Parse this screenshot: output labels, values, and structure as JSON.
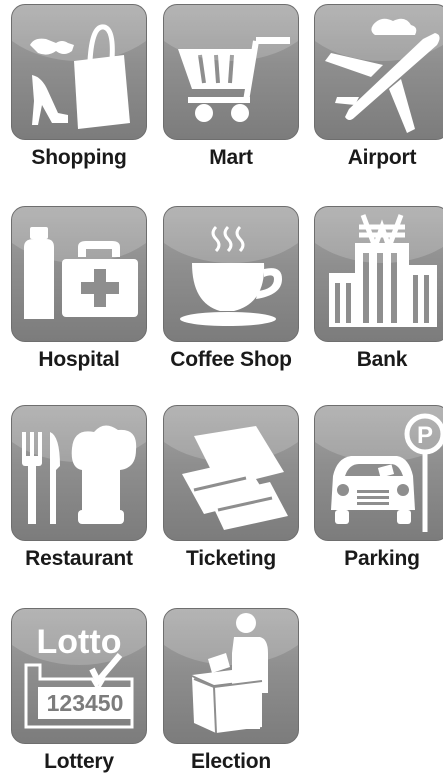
{
  "colors": {
    "icon_bg_top": "#a4a4a4",
    "icon_bg_bottom": "#7c7c7c",
    "glyph": "#ffffff",
    "label": "#1a1a1a"
  },
  "tiles": [
    {
      "label": "Shopping",
      "icon": "shopping-icon"
    },
    {
      "label": "Mart",
      "icon": "cart-icon"
    },
    {
      "label": "Airport",
      "icon": "airplane-icon"
    },
    {
      "label": "Hospital",
      "icon": "hospital-icon"
    },
    {
      "label": "Coffee Shop",
      "icon": "coffee-cup-icon"
    },
    {
      "label": "Bank",
      "icon": "bank-icon"
    },
    {
      "label": "Restaurant",
      "icon": "restaurant-icon"
    },
    {
      "label": "Ticketing",
      "icon": "ticket-icon"
    },
    {
      "label": "Parking",
      "icon": "parking-icon"
    },
    {
      "label": "Lottery",
      "icon": "lottery-icon",
      "icon_text_top": "Lotto",
      "icon_text_bottom": "123450"
    },
    {
      "label": "Election",
      "icon": "ballot-box-icon"
    }
  ]
}
